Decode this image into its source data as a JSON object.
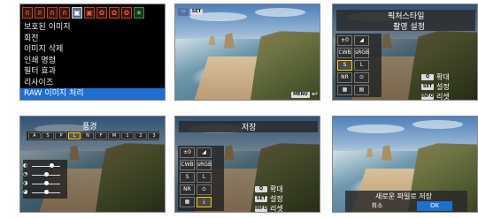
{
  "panel1": {
    "tabs": [
      {
        "label": "ត",
        "style": "red"
      },
      {
        "label": "ត",
        "style": "red"
      },
      {
        "label": "ត",
        "style": "red"
      },
      {
        "label": "ត",
        "style": "red"
      },
      {
        "label": "▣",
        "style": "active"
      },
      {
        "label": "▣",
        "style": "red"
      },
      {
        "label": "✿",
        "style": "red"
      },
      {
        "label": "✿",
        "style": "red"
      },
      {
        "label": "✿",
        "style": "red"
      },
      {
        "label": "★",
        "style": "green"
      }
    ],
    "menu_items": [
      {
        "label": "보호된 이미지",
        "selected": false
      },
      {
        "label": "회전",
        "selected": false
      },
      {
        "label": "이미지 삭제",
        "selected": false
      },
      {
        "label": "인쇄 명령",
        "selected": false
      },
      {
        "label": "필터 효과",
        "selected": false
      },
      {
        "label": "리사이즈",
        "selected": false
      },
      {
        "label": "RAW 이미지 처리",
        "selected": true
      }
    ]
  },
  "panel2": {
    "set_badge": "SET",
    "menu_badge": "MENU",
    "return_icon": "return-arrow-icon"
  },
  "panel3": {
    "title_line1": "픽처스타일",
    "title_line2": "촬영 설정",
    "icons": [
      "±0",
      "◢",
      "CWB",
      "sRGB",
      "S",
      "L"
    ],
    "buttons": [
      {
        "key": "Q",
        "label": "확대"
      },
      {
        "key": "SET",
        "label": "설정"
      },
      {
        "key": "INFO",
        "label": "리셋"
      }
    ]
  },
  "panel4": {
    "title": "풍경",
    "strip_labels": [
      "A",
      "S",
      "P",
      "L",
      "N",
      "F",
      "M",
      "1",
      "2",
      "3"
    ],
    "slider_labels": [
      "◐",
      "◔",
      "◑",
      "◕"
    ]
  },
  "panel5": {
    "title": "저장",
    "icons": [
      "±0",
      "◢",
      "CWB",
      "sRGB",
      "S",
      "L"
    ],
    "buttons": [
      {
        "key": "Q",
        "label": "확대"
      },
      {
        "key": "SET",
        "label": "설정"
      },
      {
        "key": "INFO",
        "label": "리셋"
      }
    ]
  },
  "panel6": {
    "message": "새로운 파일로 저장",
    "cancel_label": "취소",
    "ok_label": "OK"
  },
  "colors": {
    "menu_selected": "#1d6fd0",
    "tab_active": "#5a6a86",
    "tab_red": "#b8452c",
    "dialog_ok": "#1d6fd0"
  }
}
